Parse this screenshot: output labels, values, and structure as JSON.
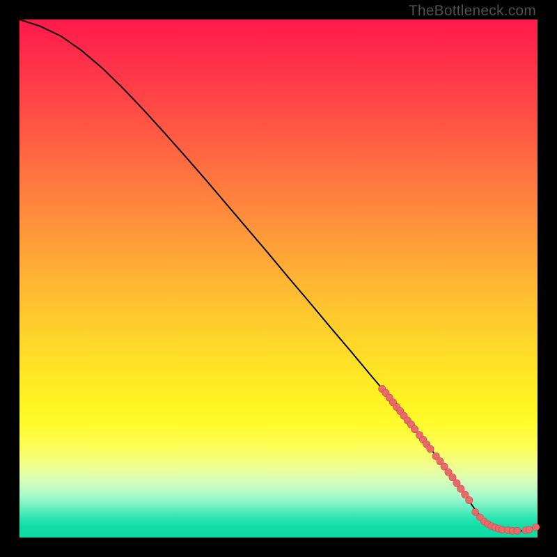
{
  "credit": "TheBottleneck.com",
  "colors": {
    "curve": "#000000",
    "marker_fill": "#e86a6a",
    "marker_stroke": "#c94f4f",
    "bg": "#000000"
  },
  "chart_data": {
    "type": "line",
    "title": "",
    "xlabel": "",
    "ylabel": "",
    "xlim": [
      0,
      100
    ],
    "ylim": [
      0,
      100
    ],
    "curve": {
      "x": [
        0,
        4,
        8,
        12,
        16,
        20,
        24,
        28,
        32,
        36,
        40,
        44,
        48,
        52,
        56,
        60,
        64,
        68,
        72,
        76,
        79,
        82,
        84.5,
        86.5,
        88,
        90,
        92.5,
        95,
        97.5,
        100
      ],
      "y": [
        100,
        98.7,
        96.8,
        94.0,
        90.6,
        86.7,
        82.5,
        78.1,
        73.6,
        69.0,
        64.3,
        59.6,
        54.9,
        50.1,
        45.4,
        40.6,
        35.9,
        31.1,
        26.4,
        21.4,
        17.6,
        13.7,
        10.3,
        7.5,
        5.3,
        2.9,
        1.5,
        1.3,
        1.3,
        2.1
      ]
    },
    "series": [
      {
        "name": "segment-markers",
        "kind": "scatter",
        "x": [
          70.0,
          70.7,
          71.4,
          72.1,
          72.8,
          73.5,
          74.2,
          74.9,
          75.6,
          76.3,
          77.2,
          77.9,
          78.6,
          79.3,
          80.4,
          81.2,
          82.0,
          82.8,
          83.6,
          84.4,
          85.2,
          86.0,
          86.8
        ],
        "y": [
          28.7,
          27.9,
          27.0,
          26.1,
          25.2,
          24.4,
          23.5,
          22.6,
          21.8,
          20.9,
          19.8,
          18.9,
          18.0,
          17.1,
          15.7,
          14.7,
          13.7,
          12.6,
          11.6,
          10.5,
          9.4,
          8.3,
          7.2
        ]
      },
      {
        "name": "flat-markers",
        "kind": "scatter",
        "x": [
          88.0,
          88.9,
          89.7,
          90.4,
          91.1,
          91.8,
          92.5,
          93.2,
          94.3,
          95.2,
          96.1,
          97.7,
          98.4,
          99.7
        ],
        "y": [
          4.9,
          3.9,
          3.1,
          2.6,
          2.2,
          1.9,
          1.7,
          1.5,
          1.4,
          1.3,
          1.3,
          1.4,
          1.5,
          2.0
        ]
      }
    ]
  }
}
